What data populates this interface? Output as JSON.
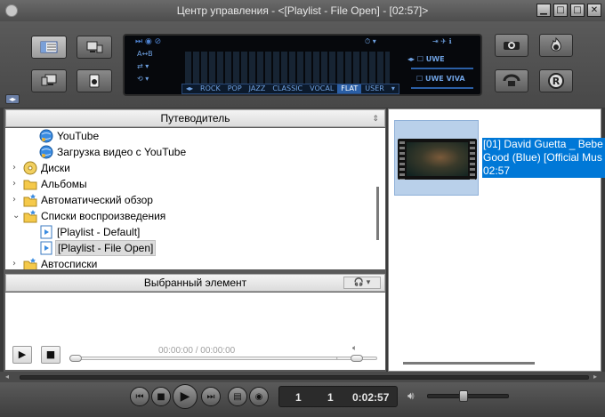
{
  "window": {
    "title": "Центр управления - <[Playlist - File Open] - [02:57]>",
    "minimize": "▁",
    "restore": "□",
    "maximize": "□",
    "close": "✕"
  },
  "equalizer": {
    "presets": [
      "◂▸",
      "ROCK",
      "POP",
      "JAZZ",
      "CLASSIC",
      "VOCAL",
      "FLAT",
      "USER",
      "▾"
    ],
    "selected_preset": "FLAT",
    "labels": {
      "uwe1": "UWE",
      "uwe2": "UWE",
      "viva": "VIVA"
    }
  },
  "navigator": {
    "header": "Путеводитель",
    "items": [
      {
        "label": "YouTube",
        "icon": "globe-icon",
        "level": 2,
        "expander": ""
      },
      {
        "label": "Загрузка видео с YouTube",
        "icon": "globe-icon",
        "level": 2,
        "expander": ""
      },
      {
        "label": "Диски",
        "icon": "disc-icon",
        "level": 1,
        "expander": "›"
      },
      {
        "label": "Альбомы",
        "icon": "folder-icon",
        "level": 1,
        "expander": "›"
      },
      {
        "label": "Автоматический обзор",
        "icon": "folder-star-icon",
        "level": 1,
        "expander": "›"
      },
      {
        "label": "Списки воспроизведения",
        "icon": "folder-star-icon",
        "level": 1,
        "expander": "⌄"
      },
      {
        "label": "[Playlist - Default]",
        "icon": "playlist-icon",
        "level": 2,
        "expander": ""
      },
      {
        "label": "[Playlist - File Open]",
        "icon": "playlist-icon",
        "level": 2,
        "expander": "",
        "selected": true
      },
      {
        "label": "Автосписки",
        "icon": "folder-star-icon",
        "level": 1,
        "expander": "›"
      }
    ]
  },
  "selected_item": {
    "header": "Выбранный элемент",
    "time": "00:00:00 / 00:00:00"
  },
  "playlist": {
    "title_line1": "[01] David Guetta _ Bebe",
    "title_line2": "Good (Blue) [Official Mus",
    "duration": "02:57"
  },
  "player": {
    "track_number": "1",
    "track_total": "1",
    "elapsed": "0:02:57",
    "volume": 0.45
  }
}
